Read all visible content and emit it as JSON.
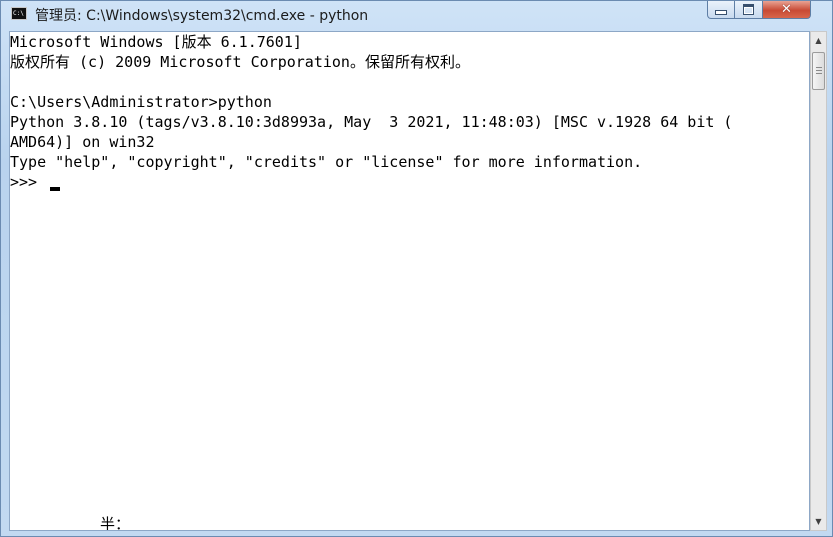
{
  "window": {
    "title": "管理员: C:\\Windows\\system32\\cmd.exe - python",
    "icon": "cmd-icon",
    "icon_text": "C:\\"
  },
  "controls": {
    "minimize_icon": "minimize-icon",
    "maximize_icon": "maximize-icon",
    "close_icon": "close-icon",
    "close_glyph": "✕"
  },
  "console": {
    "lines": [
      "Microsoft Windows [版本 6.1.7601]",
      "版权所有 (c) 2009 Microsoft Corporation。保留所有权利。",
      "",
      "C:\\Users\\Administrator>python",
      "Python 3.8.10 (tags/v3.8.10:3d8993a, May  3 2021, 11:48:03) [MSC v.1928 64 bit (",
      "AMD64)] on win32",
      "Type \"help\", \"copyright\", \"credits\" or \"license\" for more information.",
      ">>> "
    ],
    "ime_status": "半："
  },
  "scrollbar": {
    "up_glyph": "▲",
    "down_glyph": "▼"
  },
  "colors": {
    "console_background": "#ffffff",
    "console_text": "#000000",
    "close_button": "#c84a35"
  }
}
